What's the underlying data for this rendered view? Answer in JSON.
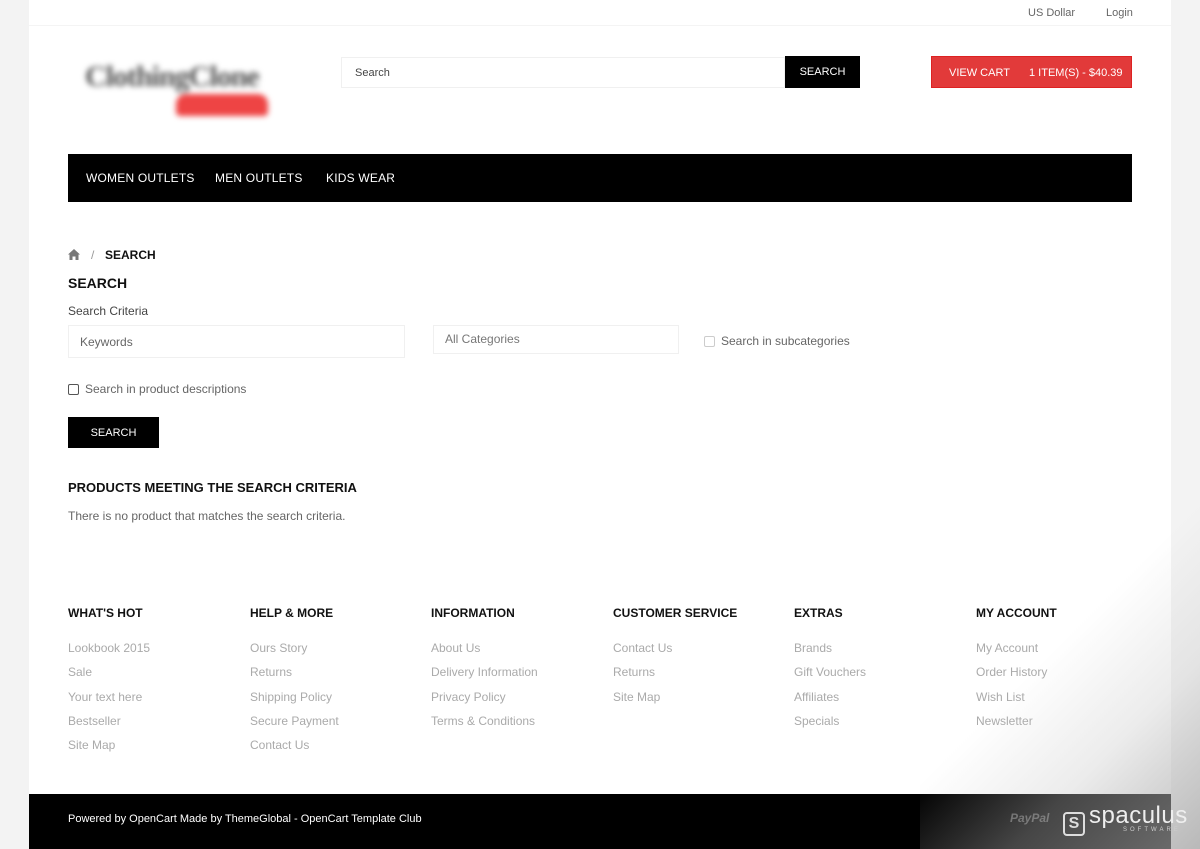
{
  "topbar": {
    "currency": "US Dollar",
    "login": "Login"
  },
  "header": {
    "logo_alt": "Clothing Store logo (blurred)",
    "search_placeholder": "Search",
    "search_button": "SEARCH",
    "cart_label": "VIEW CART",
    "cart_summary": "1 ITEM(S) - $40.39"
  },
  "nav": {
    "items": [
      "WOMEN OUTLETS",
      "MEN OUTLETS",
      "KIDS WEAR"
    ]
  },
  "breadcrumb": {
    "separator": "/",
    "current": "SEARCH"
  },
  "search": {
    "title": "SEARCH",
    "criteria_label": "Search Criteria",
    "keywords_placeholder": "Keywords",
    "category_selected": "All Categories",
    "subcategories_label": "Search in subcategories",
    "descriptions_label": "Search in product descriptions",
    "submit": "SEARCH"
  },
  "results": {
    "title": "PRODUCTS MEETING THE SEARCH CRITERIA",
    "empty_message": "There is no product that matches the search criteria."
  },
  "footer": {
    "columns": [
      {
        "title": "WHAT'S HOT",
        "links": [
          "Lookbook 2015",
          "Sale",
          "Your text here",
          "Bestseller",
          "Site Map"
        ]
      },
      {
        "title": "HELP & MORE",
        "links": [
          "Ours Story",
          "Returns",
          "Shipping Policy",
          "Secure Payment",
          "Contact Us"
        ]
      },
      {
        "title": "INFORMATION",
        "links": [
          "About Us",
          "Delivery Information",
          "Privacy Policy",
          "Terms & Conditions"
        ]
      },
      {
        "title": "CUSTOMER SERVICE",
        "links": [
          "Contact Us",
          "Returns",
          "Site Map"
        ]
      },
      {
        "title": "EXTRAS",
        "links": [
          "Brands",
          "Gift Vouchers",
          "Affiliates",
          "Specials"
        ]
      },
      {
        "title": "MY ACCOUNT",
        "links": [
          "My Account",
          "Order History",
          "Wish List",
          "Newsletter"
        ]
      }
    ],
    "powered_by": "Powered by OpenCart Made by ThemeGlobal - OpenCart Template Club",
    "payment_logo": "PayPal"
  },
  "watermark": {
    "name": "spaculus",
    "sub": "SOFTWARE"
  },
  "colors": {
    "accent": "#e23a3a",
    "dark": "#000000"
  },
  "icons": {
    "home": "home-icon"
  }
}
